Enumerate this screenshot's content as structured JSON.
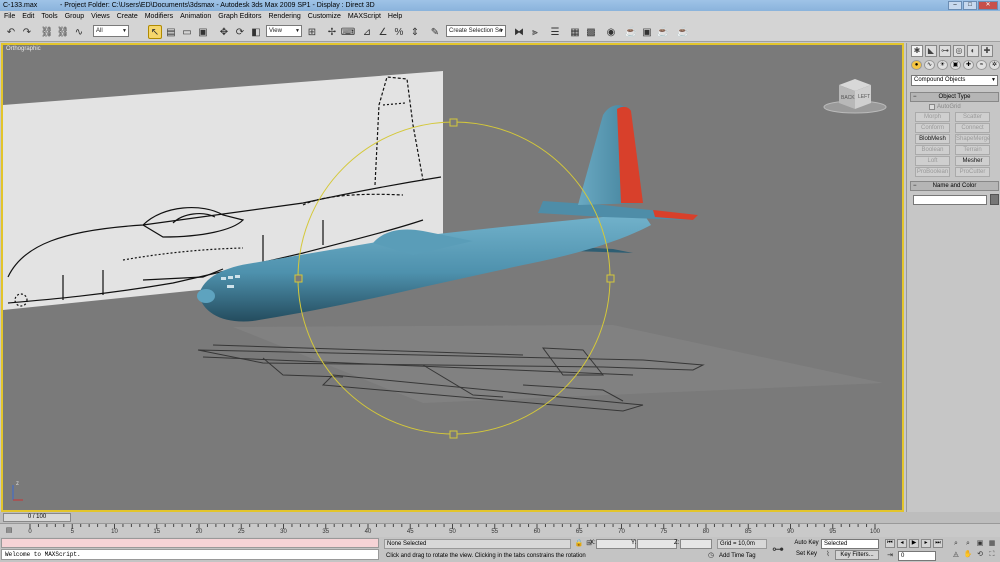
{
  "titlebar": {
    "file": "C-133.max",
    "caption": "- Project Folder: C:\\Users\\ED\\Documents\\3dsmax     - Autodesk 3ds Max  2009 SP1      - Display : Direct 3D"
  },
  "menu": [
    "File",
    "Edit",
    "Tools",
    "Group",
    "Views",
    "Create",
    "Modifiers",
    "Animation",
    "Graph Editors",
    "Rendering",
    "Customize",
    "MAXScript",
    "Help"
  ],
  "toolbar": {
    "selection_filter": "All",
    "ref_coord": "View",
    "named_selection_placeholder": "Create Selection Se"
  },
  "viewport": {
    "label": "Orthographic",
    "viewcube_left": "BACK",
    "viewcube_right": "LEFT",
    "aircraft_color": "#4e91ad",
    "tail_accent_color": "#d8402b",
    "active_border_color": "#e3c52b"
  },
  "command_panel": {
    "category": "Compound Objects",
    "rollout_object_type": "Object Type",
    "autogrid_label": "AutoGrid",
    "buttons": [
      {
        "label": "Morph",
        "enabled": false
      },
      {
        "label": "Scatter",
        "enabled": false
      },
      {
        "label": "Conform",
        "enabled": false
      },
      {
        "label": "Connect",
        "enabled": false
      },
      {
        "label": "BlobMesh",
        "enabled": true
      },
      {
        "label": "ShapeMerge",
        "enabled": false
      },
      {
        "label": "Boolean",
        "enabled": false
      },
      {
        "label": "Terrain",
        "enabled": false
      },
      {
        "label": "Loft",
        "enabled": false
      },
      {
        "label": "Mesher",
        "enabled": true
      },
      {
        "label": "ProBoolean",
        "enabled": false
      },
      {
        "label": "ProCutter",
        "enabled": false
      }
    ],
    "rollout_name_color": "Name and Color"
  },
  "timeslider": {
    "position": "0 / 100",
    "ticks": [
      "0",
      "5",
      "10",
      "15",
      "20",
      "25",
      "30",
      "35",
      "40",
      "45",
      "50",
      "55",
      "60",
      "65",
      "70",
      "75",
      "80",
      "85",
      "90",
      "95",
      "100"
    ]
  },
  "status": {
    "maxscript_output": "Welcome to MAXScript.",
    "selection": "None Selected",
    "prompt": "Click and drag to rotate the view.  Clicking in the tabs constrains the rotation",
    "x_label": "X:",
    "y_label": "Y:",
    "z_label": "Z:",
    "grid": "Grid = 10,0m",
    "add_time_tag": "Add Time Tag",
    "auto_key": "Auto Key",
    "set_key": "Set Key",
    "key_mode": "Selected",
    "key_filters": "Key Filters...",
    "current_frame": "0"
  }
}
